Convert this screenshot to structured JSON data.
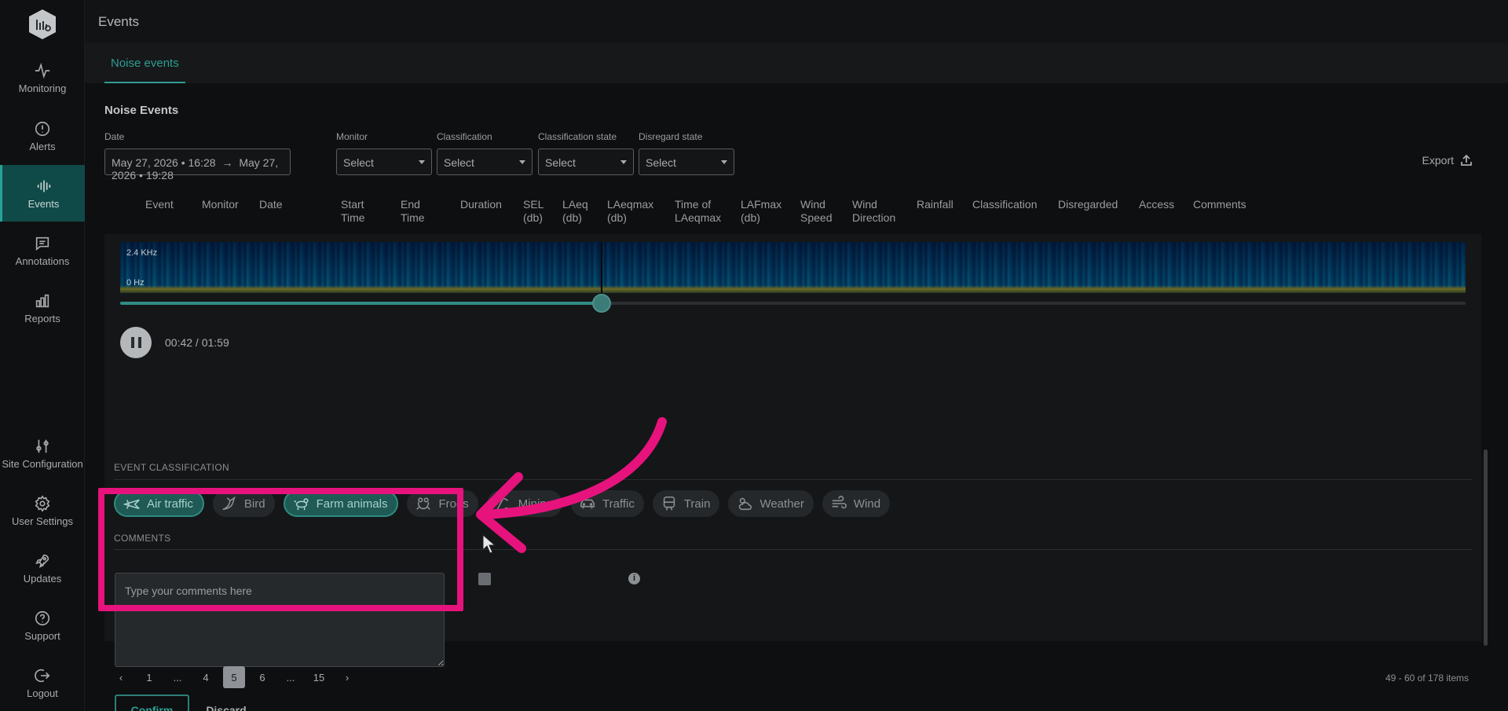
{
  "sidebar": {
    "items": [
      {
        "label": "Monitoring",
        "icon": "activity-icon"
      },
      {
        "label": "Alerts",
        "icon": "alert-circle-icon"
      },
      {
        "label": "Events",
        "icon": "waveform-icon",
        "active": true
      },
      {
        "label": "Annotations",
        "icon": "message-square-icon"
      },
      {
        "label": "Reports",
        "icon": "bar-chart-icon"
      },
      {
        "label": "Site Configuration",
        "icon": "sliders-icon"
      },
      {
        "label": "User Settings",
        "icon": "gear-icon"
      },
      {
        "label": "Updates",
        "icon": "rocket-icon"
      },
      {
        "label": "Support",
        "icon": "help-circle-icon"
      },
      {
        "label": "Logout",
        "icon": "logout-icon"
      }
    ]
  },
  "header": {
    "title": "Events"
  },
  "tabs": [
    {
      "label": "Noise events",
      "active": true
    }
  ],
  "section": {
    "title": "Noise Events"
  },
  "filters": {
    "date": {
      "label": "Date",
      "from": "May 27, 2026 • 16:28",
      "to": "May 27, 2026 • 19:28"
    },
    "monitor": {
      "label": "Monitor",
      "value": "Select"
    },
    "classification": {
      "label": "Classification",
      "value": "Select"
    },
    "classification_state": {
      "label": "Classification state",
      "value": "Select"
    },
    "disregard_state": {
      "label": "Disregard state",
      "value": "Select"
    },
    "export_label": "Export"
  },
  "columns": [
    {
      "l1": "Event",
      "l2": ""
    },
    {
      "l1": "Monitor",
      "l2": ""
    },
    {
      "l1": "Date",
      "l2": ""
    },
    {
      "l1": "Start",
      "l2": "Time"
    },
    {
      "l1": "End",
      "l2": "Time"
    },
    {
      "l1": "Duration",
      "l2": ""
    },
    {
      "l1": "SEL",
      "l2": "(db)"
    },
    {
      "l1": "LAeq",
      "l2": "(db)"
    },
    {
      "l1": "LAeqmax",
      "l2": "(db)"
    },
    {
      "l1": "Time of",
      "l2": "LAeqmax"
    },
    {
      "l1": "LAFmax",
      "l2": "(db)"
    },
    {
      "l1": "Wind",
      "l2": "Speed"
    },
    {
      "l1": "Wind",
      "l2": "Direction"
    },
    {
      "l1": "Rainfall",
      "l2": ""
    },
    {
      "l1": "Classification",
      "l2": ""
    },
    {
      "l1": "Disregarded",
      "l2": ""
    },
    {
      "l1": "Access",
      "l2": ""
    },
    {
      "l1": "Comments",
      "l2": ""
    }
  ],
  "player": {
    "freq_high": "2.4 KHz",
    "freq_low": "0   Hz",
    "time": "00:42 / 01:59",
    "progress": 0.358
  },
  "classification": {
    "title": "EVENT CLASSIFICATION",
    "chips": [
      {
        "label": "Air traffic",
        "icon": "plane-icon",
        "selected": true
      },
      {
        "label": "Bird",
        "icon": "bird-icon",
        "selected": false
      },
      {
        "label": "Farm animals",
        "icon": "farm-animals-icon",
        "selected": true
      },
      {
        "label": "Frogs",
        "icon": "frog-icon",
        "selected": false
      },
      {
        "label": "Mining",
        "icon": "pickaxe-icon",
        "selected": false
      },
      {
        "label": "Traffic",
        "icon": "car-icon",
        "selected": false
      },
      {
        "label": "Train",
        "icon": "train-icon",
        "selected": false
      },
      {
        "label": "Weather",
        "icon": "cloud-sun-icon",
        "selected": false
      },
      {
        "label": "Wind",
        "icon": "wind-icon",
        "selected": false
      }
    ]
  },
  "comments": {
    "title": "COMMENTS",
    "placeholder": "Type your comments here",
    "confirm_label": "Confirm",
    "discard_label": "Discard"
  },
  "pagination": {
    "pages": [
      "1",
      "...",
      "4",
      "5",
      "6",
      "...",
      "15"
    ],
    "current": "5",
    "info": "49 - 60 of 178 items"
  },
  "colors": {
    "accent": "#2f9d93",
    "active_nav": "#0f4a48",
    "annotation": "#e6137d"
  }
}
